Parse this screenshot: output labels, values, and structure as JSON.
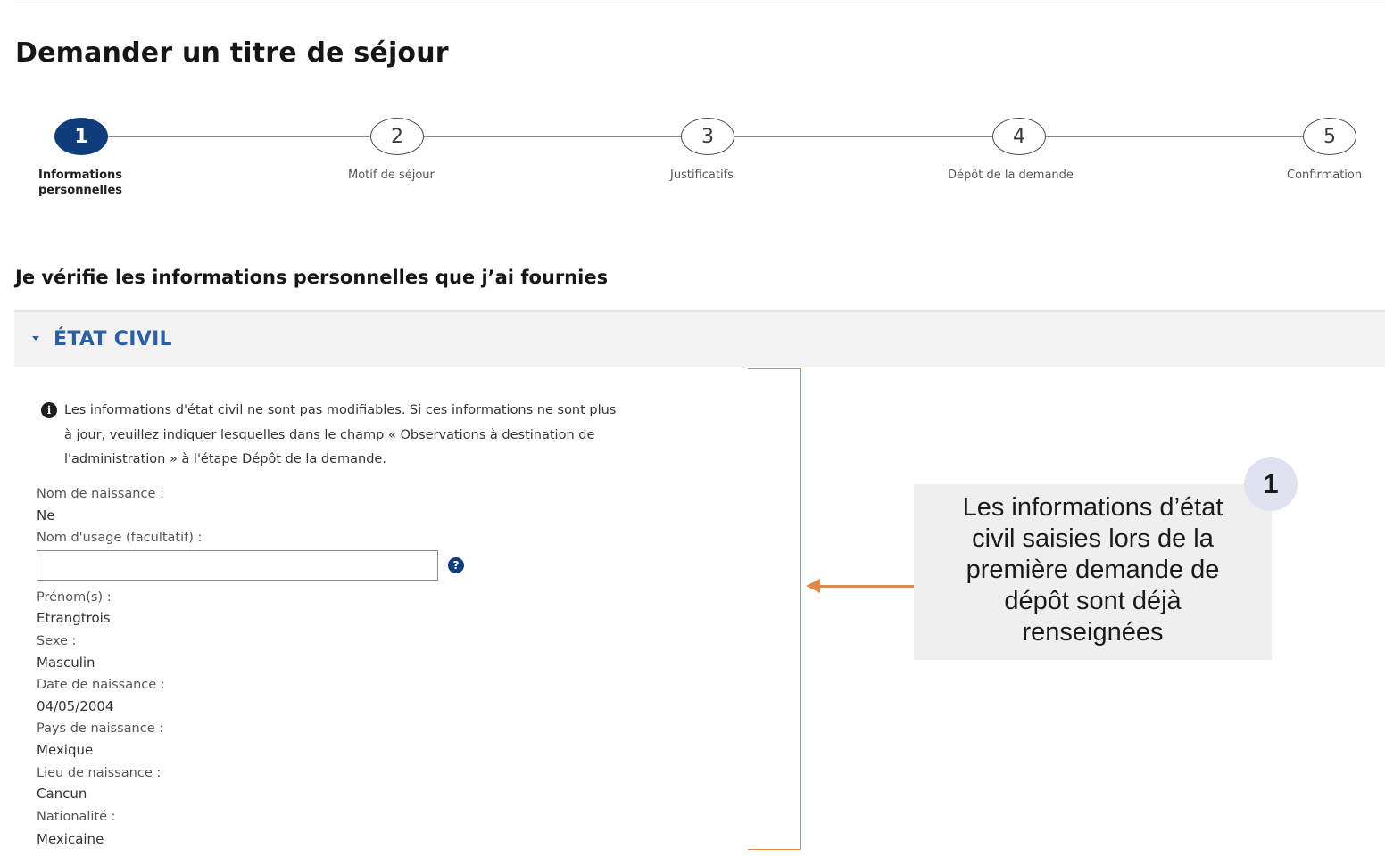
{
  "page": {
    "title": "Demander un titre de séjour"
  },
  "stepper": {
    "steps": [
      {
        "number": "1",
        "label": "Informations personnelles",
        "state": "active"
      },
      {
        "number": "2",
        "label": "Motif de séjour",
        "state": "upcoming"
      },
      {
        "number": "3",
        "label": "Justificatifs",
        "state": "upcoming"
      },
      {
        "number": "4",
        "label": "Dépôt de la demande",
        "state": "upcoming"
      },
      {
        "number": "5",
        "label": "Confirmation",
        "state": "upcoming"
      }
    ]
  },
  "section": {
    "heading": "Je vérifie les informations personnelles que j’ai fournies"
  },
  "accordion": {
    "title": "ÉTAT CIVIL",
    "expanded": true
  },
  "info": {
    "icon": "info-icon",
    "line1": "Les informations d'état civil ne sont pas modifiables. Si ces informations ne sont plus",
    "line2": "à jour, veuillez indiquer lesquelles dans le champ « Observations à destination de",
    "line3": "l'administration » à l'étape Dépôt de la demande."
  },
  "fields": {
    "nom_naissance": {
      "label": "Nom de naissance :",
      "value": "Ne"
    },
    "nom_usage": {
      "label": "Nom d'usage (facultatif) :",
      "value": "",
      "help_icon": "question-icon"
    },
    "prenoms": {
      "label": "Prénom(s) :",
      "value": "Etrangtrois"
    },
    "sexe": {
      "label": "Sexe :",
      "value": "Masculin"
    },
    "date_naissance": {
      "label": "Date de naissance :",
      "value": "04/05/2004"
    },
    "pays_naissance": {
      "label": "Pays de naissance :",
      "value": "Mexique"
    },
    "lieu_naissance": {
      "label": "Lieu de naissance :",
      "value": "Cancun"
    },
    "nationalite": {
      "label": "Nationalité :",
      "value": "Mexicaine"
    }
  },
  "callout": {
    "badge": "1",
    "line1": "Les informations d’état",
    "line2": "civil saisies lors de la",
    "line3": "première demande de",
    "line4": "dépôt sont déjà",
    "line5": "renseignées"
  },
  "colors": {
    "active_step": "#0f3d7c",
    "accordion_title": "#2a5ea6",
    "annotation": "#e0894b"
  }
}
